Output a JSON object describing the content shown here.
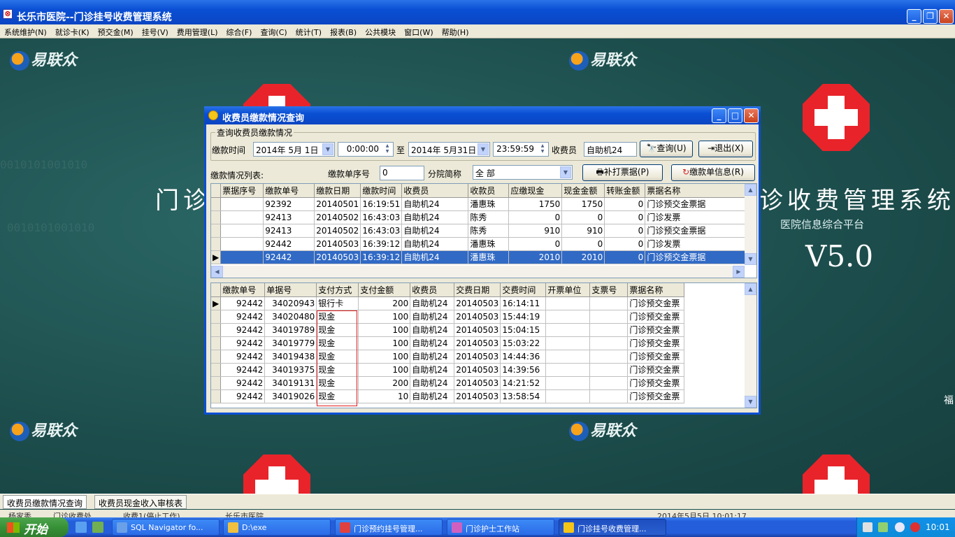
{
  "app": {
    "title": "长乐市医院--门诊挂号收费管理系统",
    "menu": [
      "系统维护(N)",
      "就诊卡(K)",
      "预交金(M)",
      "挂号(V)",
      "费用管理(L)",
      "综合(F)",
      "查询(C)",
      "统计(T)",
      "报表(B)",
      "公共模块",
      "窗口(W)",
      "帮助(H)"
    ]
  },
  "background": {
    "logo_text": "易联众",
    "system_title_left": "门诊",
    "system_title_right": "诊收费管理系统",
    "platform": "医院信息综合平台",
    "version": "V5.0",
    "edge_char": "福",
    "binary_text": "0010101001010"
  },
  "dialog": {
    "title": "收费员缴款情况查询",
    "group_label": "查询收费员缴款情况",
    "time_label": "缴款时间",
    "start_date": "2014年 5月 1日",
    "start_time": "0:00:00",
    "to_label": "至",
    "end_date": "2014年 5月31日",
    "end_time": "23:59:59",
    "cashier_label": "收费员",
    "cashier_value": "自助机24",
    "query_button": "查询(U)",
    "exit_button": "退出(X)",
    "list_label": "缴款情况列表:",
    "seq_label": "缴款单序号",
    "seq_value": "0",
    "branch_label": "分院简称",
    "branch_value": "全 部",
    "reprint_button": "补打票据(P)",
    "info_button": "缴款单信息(R)"
  },
  "upper_table": {
    "columns": [
      "票据序号",
      "缴款单号",
      "缴款日期",
      "缴款时间",
      "收费员",
      "收款员",
      "应缴现金",
      "现金金额",
      "转账金额",
      "票据名称"
    ],
    "rows": [
      [
        "",
        "92392",
        "20140501",
        "16:19:51",
        "自助机24",
        "潘惠珠",
        "1750",
        "1750",
        "0",
        "门诊预交金票据"
      ],
      [
        "",
        "92413",
        "20140502",
        "16:43:03",
        "自助机24",
        "陈秀",
        "0",
        "0",
        "0",
        "门诊发票"
      ],
      [
        "",
        "92413",
        "20140502",
        "16:43:03",
        "自助机24",
        "陈秀",
        "910",
        "910",
        "0",
        "门诊预交金票据"
      ],
      [
        "",
        "92442",
        "20140503",
        "16:39:12",
        "自助机24",
        "潘惠珠",
        "0",
        "0",
        "0",
        "门诊发票"
      ],
      [
        "",
        "92442",
        "20140503",
        "16:39:12",
        "自助机24",
        "潘惠珠",
        "2010",
        "2010",
        "0",
        "门诊预交金票据"
      ]
    ]
  },
  "lower_table": {
    "columns": [
      "缴款单号",
      "单据号",
      "支付方式",
      "支付金额",
      "收费员",
      "交费日期",
      "交费时间",
      "开票单位",
      "支票号",
      "票据名称"
    ],
    "rows": [
      [
        "92442",
        "34020943",
        "银行卡",
        "200",
        "自助机24",
        "20140503",
        "16:14:11",
        "",
        "",
        "门诊预交金票"
      ],
      [
        "92442",
        "34020480",
        "现金",
        "100",
        "自助机24",
        "20140503",
        "15:44:19",
        "",
        "",
        "门诊预交金票"
      ],
      [
        "92442",
        "34019789",
        "现金",
        "100",
        "自助机24",
        "20140503",
        "15:04:15",
        "",
        "",
        "门诊预交金票"
      ],
      [
        "92442",
        "34019779",
        "现金",
        "100",
        "自助机24",
        "20140503",
        "15:03:22",
        "",
        "",
        "门诊预交金票"
      ],
      [
        "92442",
        "34019438",
        "现金",
        "100",
        "自助机24",
        "20140503",
        "14:44:36",
        "",
        "",
        "门诊预交金票"
      ],
      [
        "92442",
        "34019375",
        "现金",
        "100",
        "自助机24",
        "20140503",
        "14:39:56",
        "",
        "",
        "门诊预交金票"
      ],
      [
        "92442",
        "34019131",
        "现金",
        "200",
        "自助机24",
        "20140503",
        "14:21:52",
        "",
        "",
        "门诊预交金票"
      ],
      [
        "92442",
        "34019026",
        "现金",
        "10",
        "自助机24",
        "20140503",
        "13:58:54",
        "",
        "",
        "门诊预交金票"
      ]
    ]
  },
  "bottom_tabs": [
    "收费员缴款情况查询",
    "收费员现金收入审核表"
  ],
  "statusbar": [
    "杨家秀",
    "门诊收费处",
    "收费1(停止工作)",
    "长乐市医院",
    "2014年5月5日 10:01:17"
  ],
  "taskbar": {
    "start": "开始",
    "tasks": [
      "SQL Navigator fo...",
      "D:\\exe",
      "门诊预约挂号管理...",
      "门诊护士工作站",
      "门诊挂号收费管理..."
    ],
    "clock": "10:01"
  },
  "colors": {
    "accent": "#0a4fd4",
    "selection": "#316ac5",
    "highlight_box": "#e02020",
    "desktop": "#1d4f4e"
  }
}
